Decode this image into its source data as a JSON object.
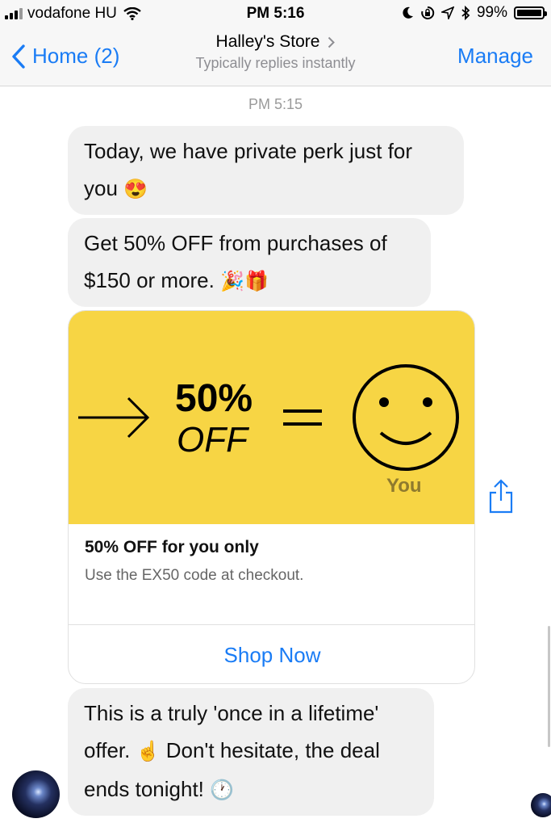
{
  "status_bar": {
    "carrier": "vodafone HU",
    "time": "PM 5:16",
    "battery_text": "99%",
    "battery_level_percent": 99
  },
  "nav": {
    "back_label": "Home (2)",
    "title": "Halley's Store",
    "subtitle": "Typically replies instantly",
    "manage_label": "Manage"
  },
  "chat": {
    "timestamp": "PM 5:15",
    "messages": [
      {
        "line1": "Today, we have private perk just for",
        "line2": "you",
        "emoji": "😍"
      },
      {
        "line1": "Get 50% OFF from purchases of",
        "line2": "$150 or more.",
        "emoji": "🎉🎁"
      },
      {
        "line1": "This is a truly 'once in a lifetime'",
        "line2a": "offer.",
        "emoji_a": "☝",
        "line2b": "Don't hesitate, the deal",
        "line3": "ends tonight!",
        "emoji_b": "🕐"
      }
    ]
  },
  "card": {
    "image_percent": "50%",
    "image_off": "OFF",
    "image_you": "You",
    "title": "50% OFF for you only",
    "subtitle": "Use the EX50 code at checkout.",
    "button_label": "Shop Now"
  },
  "colors": {
    "accent": "#1a7cf5",
    "bubble": "#f0f0f0",
    "card_yellow": "#f7d544"
  },
  "icons": [
    "signal-icon",
    "wifi-icon",
    "moon-icon",
    "rotation-lock-icon",
    "location-icon",
    "bluetooth-icon",
    "battery-icon",
    "back-chevron-icon",
    "chevron-right-icon",
    "share-icon",
    "avatar"
  ]
}
